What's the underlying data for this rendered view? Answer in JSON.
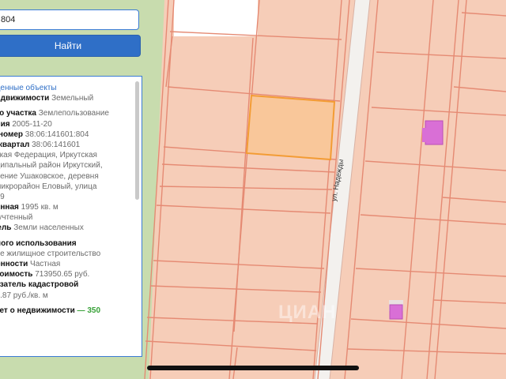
{
  "search": {
    "value": "804"
  },
  "find_button": {
    "label": "Найти"
  },
  "results": {
    "header": "йденные объекты",
    "lines": [
      {
        "bold": " недвижимости",
        "text": " Земельный"
      },
      {
        "bold": "",
        "text": ""
      },
      {
        "bold": "ого участка",
        "text": " Землепользование"
      },
      {
        "bold": "ения",
        "text": " 2005-11-20"
      },
      {
        "bold": "й номер",
        "text": " 38:06:141601:804"
      },
      {
        "bold": "й квартал",
        "text": " 38:06:141601"
      },
      {
        "bold": "",
        "text": "йская Федерация, Иркутская"
      },
      {
        "bold": "",
        "text": "иципальный район Иркутский,"
      },
      {
        "bold": "",
        "text": "еление Ушаковское, деревня"
      },
      {
        "bold": "",
        "text": ", микрорайон Еловый, улица"
      },
      {
        "bold": "",
        "text": ". 39"
      },
      {
        "bold": "ченная",
        "text": " 1995 кв. м"
      },
      {
        "bold": "",
        "text": "е учтенный"
      },
      {
        "bold": "мель",
        "text": " Земли населенных"
      },
      {
        "bold": "",
        "text": ""
      },
      {
        "bold": "нного использования",
        "text": ""
      },
      {
        "bold": "",
        "text": "ное жилищное строительство"
      },
      {
        "bold": "венности",
        "text": " Частная"
      },
      {
        "bold": " стоимость",
        "text": " 713950.65 руб."
      },
      {
        "bold": "казатель кадастровой",
        "text": ""
      },
      {
        "bold": "",
        "text": "57.87 руб./кв. м"
      },
      {
        "bold": "",
        "text": ""
      },
      {
        "bold": "тает о недвижимости",
        "text": ""
      }
    ],
    "last_line_green": "— 350"
  },
  "map": {
    "street_label": "ул. Надежды",
    "watermark": "ЦИАН",
    "colors": {
      "parcel_fill": "#f6cdb8",
      "parcel_border": "#e58a73",
      "selected_fill": "#f9c79a",
      "selected_border": "#f39c34",
      "road": "#f3f1ee",
      "green_strip": "#c8dcae",
      "building": "#d96fd6"
    }
  }
}
